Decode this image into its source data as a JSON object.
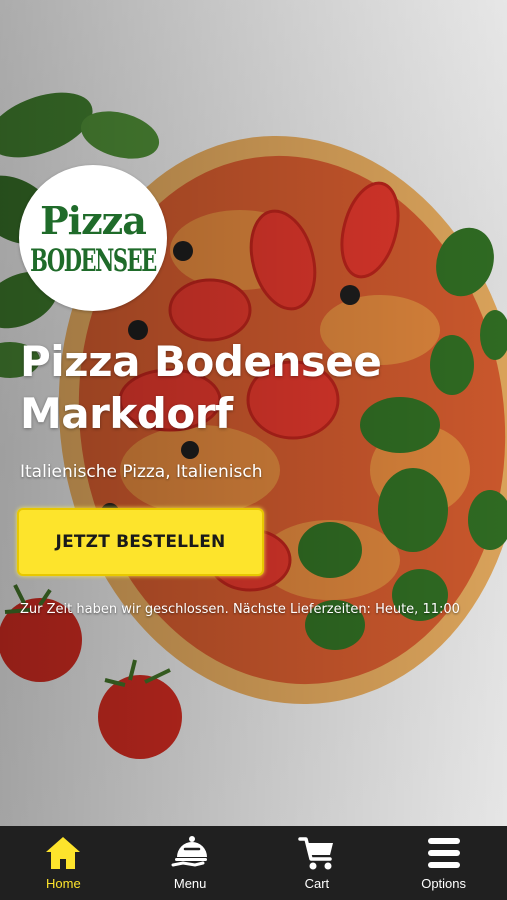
{
  "brand": {
    "logo_line1": "Pizza",
    "logo_line2": "BODENSEE",
    "logo_color": "#1f6b2a"
  },
  "hero": {
    "title": "Pizza Bodensee Markdorf",
    "subtitle": "Italienische Pizza, Italienisch",
    "order_button": "JETZT BESTELLEN",
    "status": "Zur Zeit haben wir geschlossen. Nächste Lieferzeiten: Heute, 11:00",
    "accent_color": "#fde42c"
  },
  "nav": {
    "items": [
      {
        "label": "Home",
        "icon": "home-icon",
        "active": true
      },
      {
        "label": "Menu",
        "icon": "cloche-icon",
        "active": false
      },
      {
        "label": "Cart",
        "icon": "cart-icon",
        "active": false
      },
      {
        "label": "Options",
        "icon": "menu-bars-icon",
        "active": false
      }
    ]
  }
}
